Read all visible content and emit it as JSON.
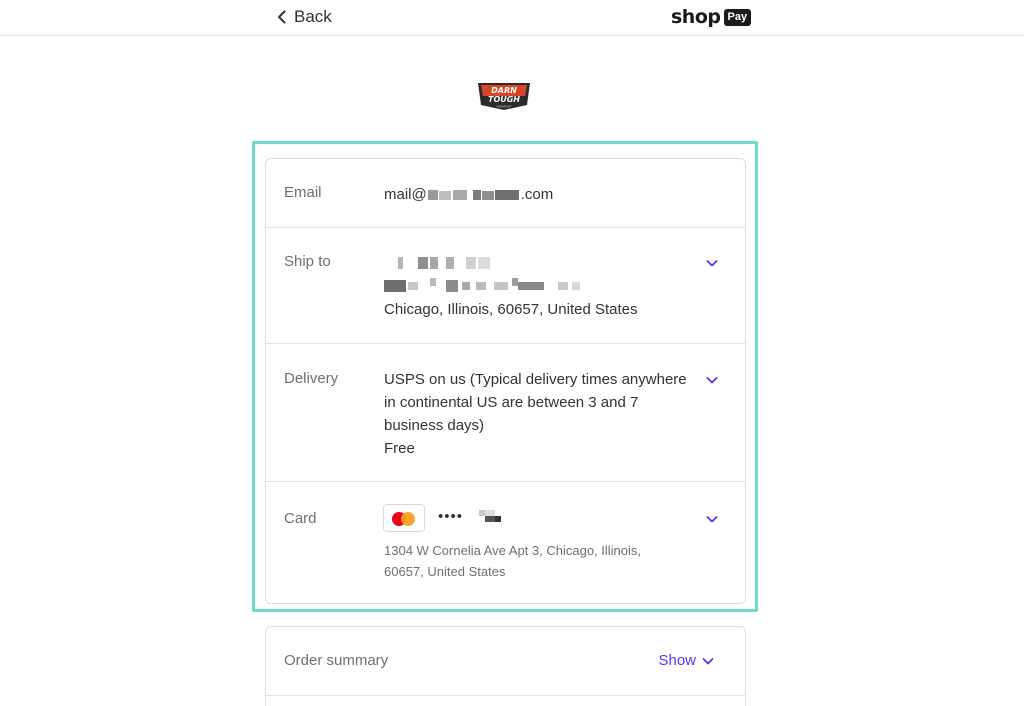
{
  "header": {
    "back_label": "Back",
    "brand_shop": "shop",
    "brand_pay": "Pay"
  },
  "merchant_logo": {
    "line1": "DARN",
    "line2": "TOUGH",
    "line3": "VERMONT"
  },
  "details": {
    "email": {
      "label": "Email",
      "value_prefix": "mail@",
      "value_suffix": ".com"
    },
    "ship_to": {
      "label": "Ship to",
      "address_line": "Chicago, Illinois, 60657, United States"
    },
    "delivery": {
      "label": "Delivery",
      "method": "USPS on us (Typical delivery times anywhere in continental US are between 3 and 7 business days)",
      "price": "Free"
    },
    "card": {
      "label": "Card",
      "masked": "••••",
      "billing_address": "1304 W Cornelia Ave Apt 3, Chicago, Illinois, 60657, United States"
    }
  },
  "order_summary": {
    "label": "Order summary",
    "toggle_label": "Show"
  },
  "colors": {
    "accent": "#5a31f4",
    "highlight": "#6fdccb",
    "mastercard_red": "#eb001b",
    "mastercard_orange": "#f79e1b"
  },
  "icons": {
    "back": "chevron-left-icon",
    "expand": "chevron-down-icon",
    "card_brand": "mastercard-icon"
  }
}
